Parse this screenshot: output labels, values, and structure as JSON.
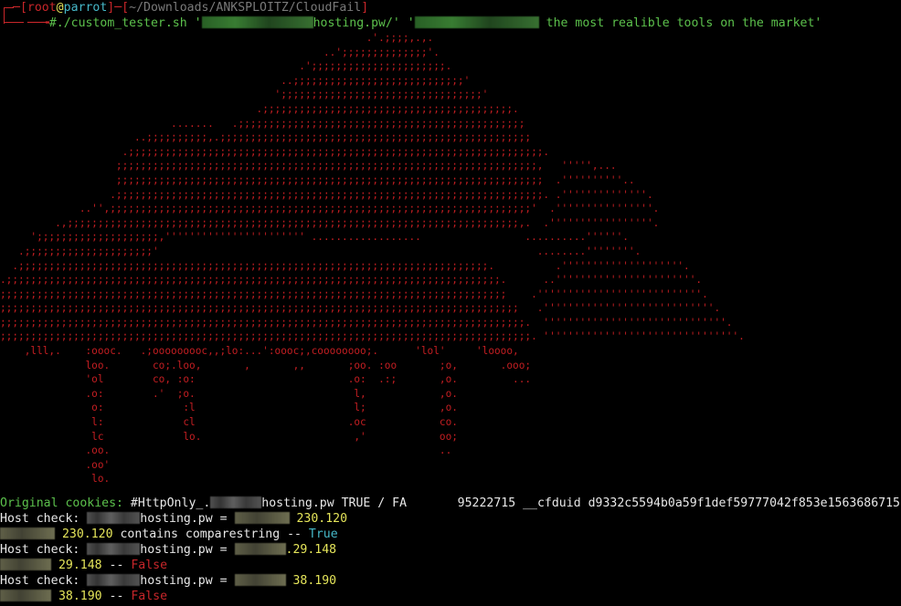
{
  "prompt": {
    "user": "root",
    "at": "@",
    "host": "parrot",
    "path": "~/Downloads/ANKSPLOITZ/CloudFail",
    "open": "[",
    "close": "]",
    "dash": "─",
    "arrow": "──╼",
    "command": "#./custom_tester.sh '",
    "arg1_tail": "hosting.pw/' '",
    "arg2_tail": " the most realible tools on the market'"
  },
  "ascii_art": [
    "                                                            .'.;;;;,.,.",
    "                                                     ..';;;;;;;;;;;;;;'.",
    "                                                 .';;;;;;;;;;;;;;;;;;;;;;.",
    "                                              ..;;;;;;;;;;;;;;;;;;;;;;;;;;;;'",
    "                                             ';;;;;;;;;;;;;;;;;;;;;;;;;;;;;;;;;'",
    "                                          .;;;;;;;;;;;;;;;;;;;;;;;;;;;;;;;;;;;;;;;;;.",
    "                            .......   .;;;;;;;;;;;;;;;;;;;;;;;;;;;;;;;;;;;;;;;;;;;;;;;",
    "                      ..;;;;;;;;;;,.;;;;;;;;;;;;;;;;;;;;;;;;;;;;;;;;;;;;;;;;;;;;;;;;;;;",
    "                    .;;;;;;;;;;;;;;;;;;;;;;;;;;;;;;;;;;;;;;;;;;;;;;;;;;;;;;;;;;;;;;;;;;;;.",
    "                   ;;;;;;;;;;;;;;;;;;;;;;;;;;;;;;;;;;;;;;;;;;;;;;;;;;;;;;;;;;;;;;;;;;;;;,   ''''',...",
    "                   ;;;;;;;;;;;;;;;;;;;;;;;;;;;;;;;;;;;;;;;;;;;;;;;;;;;;;;;;;;;;;;;;;;;;;;  .''''''''''..",
    "                  .;;;;;;;;;;;;;;;;;;;;;;;;;;;;;;;;;;;;;;;;;;;;;;;;;;;;;;;;;;;;;;;;;;;;;;. .''''''''''''''.",
    "             ..'',;;;;;;;;;;;;;;;;;;;;;;;;;;;;;;;;;;;;;;;;;;;;;;;;;;;;;;;;;;;;;;;;;;;;;'  .''''''''''''''''.",
    "         .,;;;;;;;;;;;;;;;;;;;;;;;;;;;;;;;;;;;;;;;;;;;;;;;;;;;;;;;;;;;;;;;;;;;;;;;;;;,.  .'''''''''''''''''.",
    "     ';;;;;;;;;;;;;;;;;;;;,''''''''''''''''''''''' ..................                 ..........''''''.",
    "   .;;;;;;;;;;;;;;;;;;;;;'                                                              ........''''''''.",
    "  .;;;;;;;;;;;;;;;;;;;;;;;;;;;;;;;;;;;;;;;;;;;;;;;;;;;;;;;;;;;;;;;;;;;;;;;;;;;;;.          .''''''''''''''''''''.",
    ".;;;;;;;;;;;;;;;;;;;;;;;;;;;;;;;;;;;;;;;;;;;;;;;;;;;;;;;;;;;;;;;;;;;;;;;;;;;;;;;;;.      ..'''''''''''''''''''''''.",
    ";;;;;;;;;;;;;;;;;;;;;;;;;;;;;;;;;;;;;;;;;;;;;;;;;;;;;;;;;;;;;;;;;;;;;;;;;;;;;;;;;;;    .'''''''''''''''''''''''''''.",
    ";;;;;;;;;;;;;;;;;;;;;;;;;;;;;;;;;;;;;;;;;;;;;;;;;;;;;;;;;;;;;;;;;;;;;;;;;;;;;;;;;;;;;   .''''''''''''''''''''''''''''.",
    ";;;;;;;;;;;;;;;;;;;;;;;;;;;;;;;;;;;;;;;;;;;;;;;;;;;;;;;;;;;;;;;;;;;;;;;;;;;;;;;;;;;;;;.  ''''''''''''''''''''''''''''''.",
    ";;;;;;;;;;;;;;;;;;;;;;;;;;;;;;;;;;;;;;;;;;;;;;;;;;;;;;;;;;;;;;;;;;;;;;;;;;;;;;;;;;;;;;;. ''''''''''''''''''''''''''''''''.",
    "    ,lll,.    :oooc.   .;ooooooooc,,;lo:...':oooc;,coooooooo;.      'lol'     'loooo,",
    "              loo.       co;.loo,       ,       ,,       ;oo. :oo       ;o,       .ooo;",
    "              'ol        co, :o:                         .o:  .:;       ,o.         ...",
    "              .o:        .'  ;o.                          l,            ,o.",
    "               o:             :l                          l;            ,o.",
    "               l:             cl                         .oc            co.",
    "               lc             lo.                         ,'            oo;",
    "              .oo.                                                      ..",
    "              .oo'",
    "               lo."
  ],
  "cookies": {
    "label": "Original cookies:",
    "prefix": " #HttpOnly_.",
    "domain_tail": "hosting.pw TRUE / FA",
    "spacer": "       ",
    "number": "95222715",
    "cfduid_label": " __cfduid ",
    "cfduid_value": "d9332c5594b0a59f1def59777042f853e1563686715"
  },
  "checks": [
    {
      "label": "Host check: ",
      "domain_tail": "hosting.pw = ",
      "ip_tail": " 230.120",
      "result_ip_tail": " 230.120",
      "result_text": " contains comparestring -- ",
      "result_value": "True"
    },
    {
      "label": "Host check: ",
      "domain_tail": "hosting.pw = ",
      "ip_tail": ".29.148",
      "result_ip_tail": " 29.148",
      "result_text": " -- ",
      "result_value": "False"
    },
    {
      "label": "Host check: ",
      "domain_tail": "hosting.pw = ",
      "ip_tail": " 38.190",
      "result_ip_tail": " 38.190",
      "result_text": " -- ",
      "result_value": "False"
    }
  ],
  "colors": {
    "background": "#000000",
    "prompt_red": "#c8262a",
    "path_dim": "#7a7a7a",
    "command_green": "#5cc14c",
    "number_yellow": "#e5e55a",
    "true_cyan": "#46b9c9",
    "false_red": "#c8262a"
  }
}
